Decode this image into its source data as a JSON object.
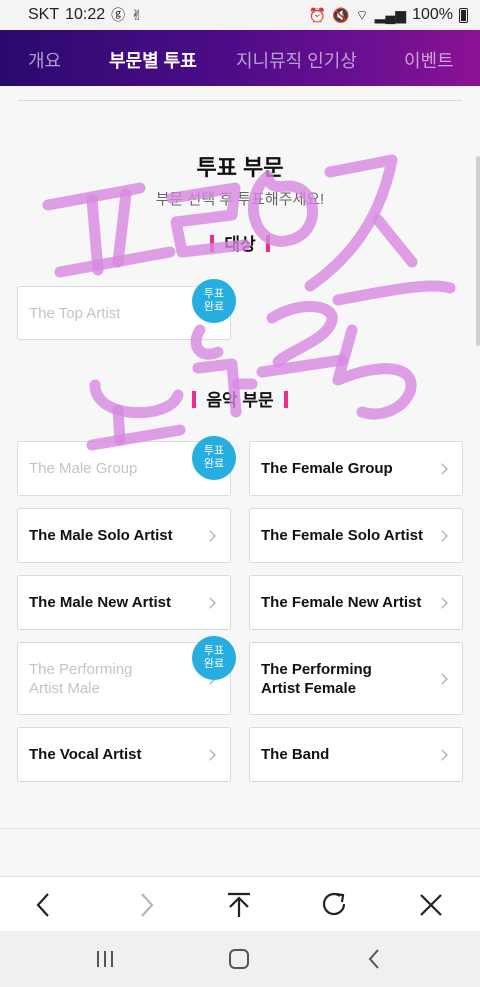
{
  "status_bar": {
    "carrier": "SKT",
    "time": "10:22",
    "battery": "100%"
  },
  "tabs": [
    {
      "label": "개요"
    },
    {
      "label": "부문별 투표",
      "active": true
    },
    {
      "label": "지니뮤직 인기상"
    },
    {
      "label": "이벤트"
    }
  ],
  "section": {
    "title": "투표 부문",
    "subtitle": "부문 선택 후 투표해주세요!"
  },
  "grand_prize": {
    "heading": "대상",
    "cards": [
      {
        "label": "The Top Artist",
        "voted": true
      }
    ]
  },
  "music": {
    "heading": "음악 부문",
    "cards": [
      {
        "label": "The Male Group",
        "voted": true
      },
      {
        "label": "The Female Group",
        "voted": false
      },
      {
        "label": "The Male Solo Artist",
        "voted": false
      },
      {
        "label": "The Female Solo Artist",
        "voted": false
      },
      {
        "label": "The Male New Artist",
        "voted": false
      },
      {
        "label": "The Female New Artist",
        "voted": false
      },
      {
        "label": "The Performing\nArtist Male",
        "voted": true
      },
      {
        "label": "The Performing\nArtist Female",
        "voted": false
      },
      {
        "label": "The Vocal Artist",
        "voted": false
      },
      {
        "label": "The Band",
        "voted": false
      }
    ]
  },
  "badge_label": "투표\n완료",
  "browser_toolbar": [
    "back-icon",
    "forward-icon",
    "scroll-top-icon",
    "refresh-icon",
    "close-icon"
  ],
  "android_nav": [
    "recent-apps-icon",
    "home-icon",
    "back-icon"
  ],
  "colors": {
    "tab_gradient_start": "#2a0a6e",
    "tab_gradient_end": "#8c1293",
    "badge": "#27aee0",
    "heading_bar": "#ec2e8e",
    "doodle": "#d787e0"
  }
}
